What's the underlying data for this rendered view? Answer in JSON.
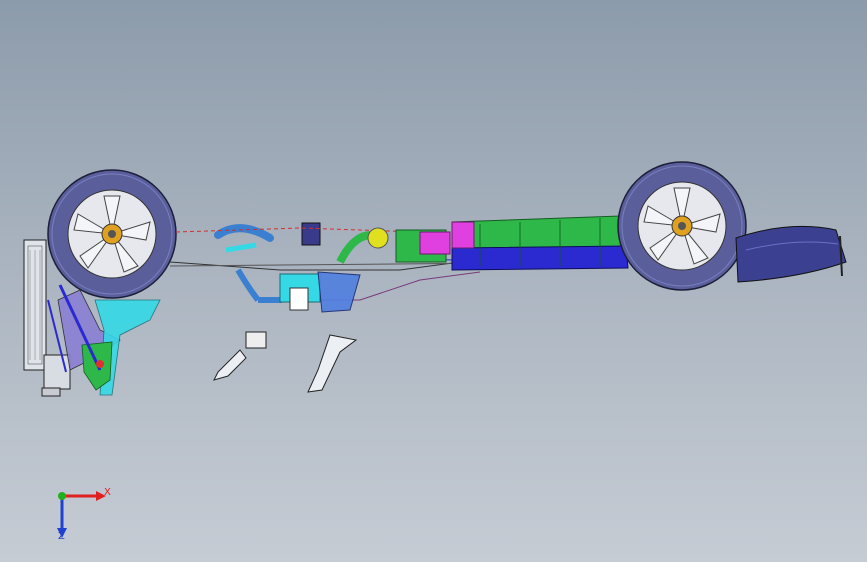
{
  "colors": {
    "background_top": "#8c9bab",
    "background_bottom": "#c6ccd4",
    "tire": "#5a5f9c",
    "tank_green": "#2fb84a",
    "tank_blue": "#2a2ad0",
    "tank_magenta": "#e040e0",
    "cyan_part": "#35d9e6",
    "axis_x": "#e02020",
    "axis_y": "#20b020",
    "axis_z": "#2040d0"
  },
  "icons": {
    "front_wheel": "wheel-icon",
    "rear_wheel": "wheel-icon",
    "triad": "coordinate-triad-icon"
  },
  "triad": {
    "x_label": "X",
    "z_label": "Z"
  }
}
